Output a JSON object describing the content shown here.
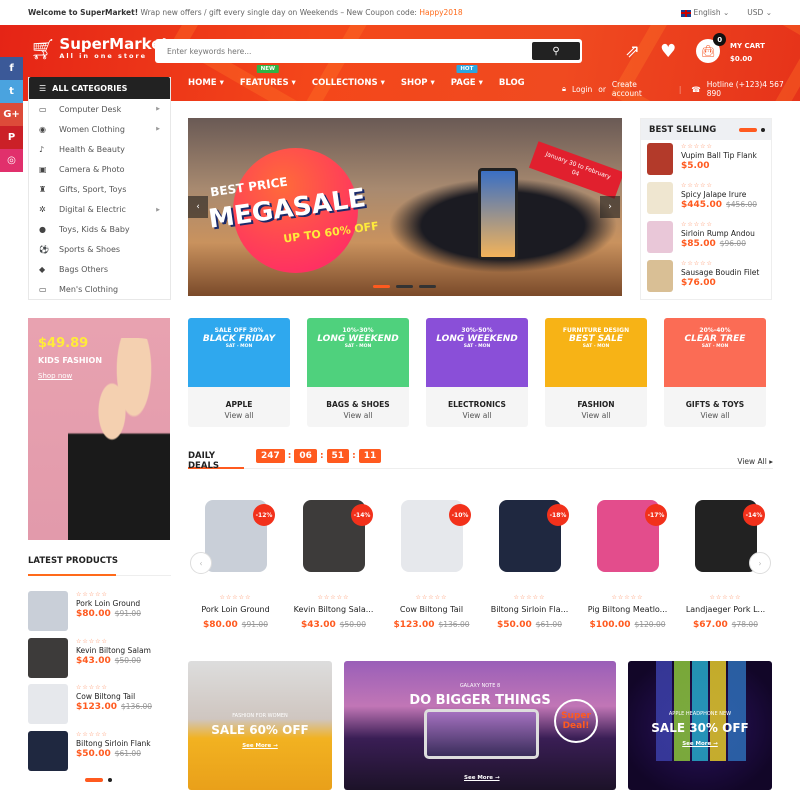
{
  "topbar": {
    "welcome_bold": "Welcome to SuperMarket!",
    "welcome_text": " Wrap new offers / gift every single day on Weekends – New Coupon code: ",
    "coupon": "Happy2018",
    "language": "English",
    "currency": "USD"
  },
  "header": {
    "logo_name": "SuperMarket",
    "logo_tagline": "All in one store",
    "search_placeholder": "Enter keywords here...",
    "cart_count": "0",
    "cart_label": "MY CART",
    "cart_total": "$0.00"
  },
  "nav": {
    "items": [
      {
        "label": "HOME"
      },
      {
        "label": "FEATURES",
        "badge": "NEW",
        "badge_color": "#2fb344"
      },
      {
        "label": "COLLECTIONS"
      },
      {
        "label": "SHOP"
      },
      {
        "label": "PAGE",
        "badge": "HOT",
        "badge_color": "#2ba6e0"
      },
      {
        "label": "BLOG"
      }
    ],
    "login": "Login",
    "or": "or",
    "create_account": "Create account",
    "hotline": "Hotline (+123)4 567 890"
  },
  "social": [
    {
      "name": "facebook",
      "glyph": "f",
      "color": "#3b5998"
    },
    {
      "name": "twitter",
      "glyph": "t",
      "color": "#4aa3df"
    },
    {
      "name": "google-plus",
      "glyph": "G+",
      "color": "#dd4b39"
    },
    {
      "name": "pinterest",
      "glyph": "P",
      "color": "#cb2027"
    },
    {
      "name": "instagram",
      "glyph": "◎",
      "color": "#e1306c"
    }
  ],
  "categories": {
    "title": "ALL CATEGORIES",
    "items": [
      {
        "label": "Computer Desk",
        "icon": "monitor",
        "glyph": "▭",
        "submenu": true
      },
      {
        "label": "Women Clothing",
        "icon": "circle",
        "glyph": "◉",
        "submenu": true
      },
      {
        "label": "Health & Beauty",
        "icon": "runner",
        "glyph": "♪",
        "submenu": false
      },
      {
        "label": "Camera & Photo",
        "icon": "camera",
        "glyph": "▣",
        "submenu": false
      },
      {
        "label": "Gifts, Sport, Toys",
        "icon": "gift",
        "glyph": "♜",
        "submenu": false
      },
      {
        "label": "Digital & Electric",
        "icon": "snowflake",
        "glyph": "✲",
        "submenu": true
      },
      {
        "label": "Toys, Kids & Baby",
        "icon": "globe",
        "glyph": "●",
        "submenu": false
      },
      {
        "label": "Sports & Shoes",
        "icon": "soccer-ball",
        "glyph": "⚽",
        "submenu": false
      },
      {
        "label": "Bags Others",
        "icon": "bag",
        "glyph": "◆",
        "submenu": false
      },
      {
        "label": "Men's Clothing",
        "icon": "monitor",
        "glyph": "▭",
        "submenu": false
      }
    ]
  },
  "slider": {
    "line1": "BEST PRICE",
    "line2": "MEGASALE",
    "line3": "UP TO 60% OFF",
    "tag": "January 30 to February 04",
    "slides": 3,
    "active_slide": 1
  },
  "best_selling": {
    "title": "BEST SELLING",
    "items": [
      {
        "name": "Vupim Ball Tip Flank",
        "price": "$5.00",
        "old_price": "",
        "thumb_color": "#b33a2a"
      },
      {
        "name": "Spicy Jalape Irure",
        "price": "$445.00",
        "old_price": "$456.00",
        "thumb_color": "#efe6d0"
      },
      {
        "name": "Sirloin Rump Andou",
        "price": "$85.00",
        "old_price": "$96.00",
        "thumb_color": "#e9c7d8"
      },
      {
        "name": "Sausage Boudin Filet",
        "price": "$76.00",
        "old_price": "",
        "thumb_color": "#d9bf95"
      }
    ]
  },
  "kids_banner": {
    "price": "$49.89",
    "title": "KIDS FASHION",
    "link": "Shop now"
  },
  "category_cards": [
    {
      "name": "APPLE",
      "link": "View all",
      "l1": "SALE OFF 30%",
      "l2": "BLACK FRIDAY",
      "l3": "SAT - MON",
      "color": "#2fa8ee"
    },
    {
      "name": "BAGS & SHOES",
      "link": "View all",
      "l1": "10%-30%",
      "l2": "LONG WEEKEND",
      "l3": "SAT - MON",
      "color": "#4fd17d"
    },
    {
      "name": "ELECTRONICS",
      "link": "View all",
      "l1": "30%-50%",
      "l2": "LONG WEEKEND",
      "l3": "SAT - MON",
      "color": "#8a4fd8"
    },
    {
      "name": "FASHION",
      "link": "View all",
      "l1": "FURNITURE DESIGN",
      "l2": "BEST SALE",
      "l3": "SAT - MON",
      "color": "#f7b316"
    },
    {
      "name": "GIFTS & TOYS",
      "link": "View all",
      "l1": "20%-40%",
      "l2": "CLEAR TREE",
      "l3": "SAT - MON",
      "color": "#fb6c55"
    }
  ],
  "daily_deals": {
    "title": "DAILY DEALS",
    "timer": [
      "247",
      "06",
      "51",
      "11"
    ],
    "view_all": "View All",
    "products": [
      {
        "name": "Pork Loin Ground",
        "price": "$80.00",
        "old_price": "$91.00",
        "discount": "-12%",
        "color": "#c9cfd8"
      },
      {
        "name": "Kevin Biltong Sala...",
        "price": "$43.00",
        "old_price": "$50.00",
        "discount": "-14%",
        "color": "#3d3b3a"
      },
      {
        "name": "Cow Biltong Tail",
        "price": "$123.00",
        "old_price": "$136.00",
        "discount": "-10%",
        "color": "#e6e8ec"
      },
      {
        "name": "Biltong Sirloin Fla...",
        "price": "$50.00",
        "old_price": "$61.00",
        "discount": "-18%",
        "color": "#1f2840"
      },
      {
        "name": "Pig Biltong Meatlo...",
        "price": "$100.00",
        "old_price": "$120.00",
        "discount": "-17%",
        "color": "#e34d8c"
      },
      {
        "name": "Landjaeger Pork L...",
        "price": "$67.00",
        "old_price": "$78.00",
        "discount": "-14%",
        "color": "#222222"
      }
    ]
  },
  "latest_products": {
    "title": "LATEST PRODUCTS",
    "items": [
      {
        "name": "Pork Loin Ground",
        "price": "$80.00",
        "old_price": "$91.00",
        "color": "#c9cfd8"
      },
      {
        "name": "Kevin Biltong Salam",
        "price": "$43.00",
        "old_price": "$50.00",
        "color": "#3d3b3a"
      },
      {
        "name": "Cow Biltong Tail",
        "price": "$123.00",
        "old_price": "$136.00",
        "color": "#e6e8ec"
      },
      {
        "name": "Biltong Sirloin Flank",
        "price": "$50.00",
        "old_price": "$61.00",
        "color": "#1f2840"
      }
    ]
  },
  "banners": [
    {
      "small": "FASHION FOR WOMEN",
      "big": "SALE 60% OFF",
      "link": "See More →"
    },
    {
      "small": "GALAXY NOTE 8",
      "big": "DO BIGGER THINGS",
      "link": "See More →",
      "badge": "Super Deal!"
    },
    {
      "small": "APPLE HEADPHONE NEW",
      "big": "SALE 30% OFF",
      "link": "See More →"
    }
  ],
  "colors": {
    "accent": "#ff5a1f",
    "header": "#f4471a",
    "dark": "#222222"
  }
}
